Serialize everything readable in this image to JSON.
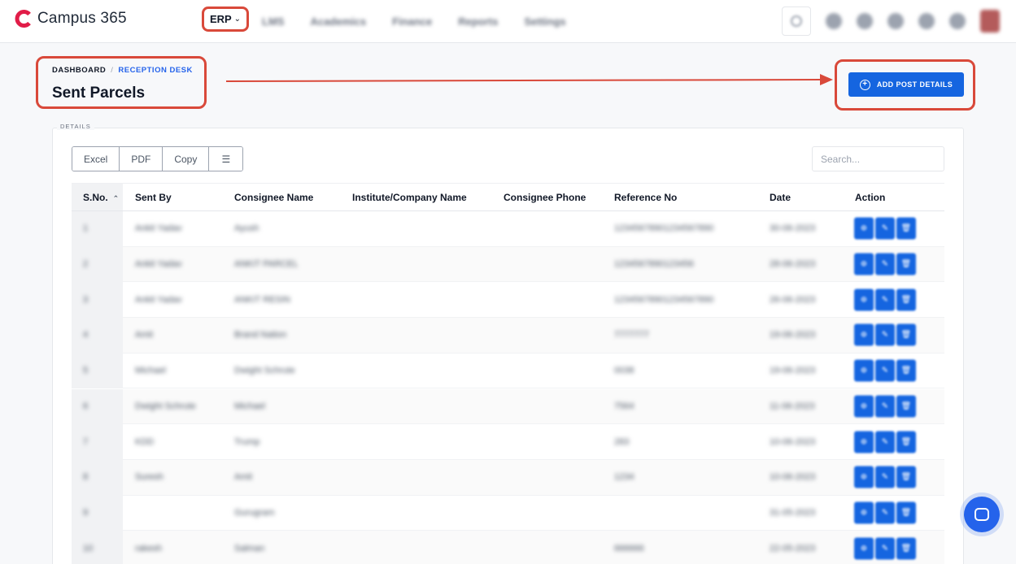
{
  "app": {
    "name": "Campus 365",
    "brand_color": "#e11d48",
    "accent": "#1565e0",
    "highlight": "#d9493a"
  },
  "nav": {
    "erp_label": "ERP",
    "items": [
      "LMS",
      "Academics",
      "Finance",
      "Reports",
      "Settings"
    ]
  },
  "breadcrumb": {
    "root": "DASHBOARD",
    "separator": "/",
    "current": "RECEPTION DESK"
  },
  "page_title": "Sent Parcels",
  "add_button_label": "ADD POST DETAILS",
  "details_legend": "DETAILS",
  "export": {
    "excel": "Excel",
    "pdf": "PDF",
    "copy": "Copy"
  },
  "search": {
    "placeholder": "Search..."
  },
  "table": {
    "headers": [
      "S.No.",
      "Sent By",
      "Consignee Name",
      "Institute/Company Name",
      "Consignee Phone",
      "Reference No",
      "Date",
      "Action"
    ],
    "rows": [
      [
        "1",
        "Ankit Yadav",
        "Ayush",
        "",
        "",
        "12345678901234567890",
        "30-06-2023"
      ],
      [
        "2",
        "Ankit Yadav",
        "ANKIT PARCEL",
        "",
        "",
        "1234567890123456",
        "28-06-2023"
      ],
      [
        "3",
        "Ankit Yadav",
        "ANKIT RESIN",
        "",
        "",
        "12345678901234567890",
        "26-06-2023"
      ],
      [
        "4",
        "Amit",
        "Brand Nation",
        "",
        "",
        "7777777",
        "19-06-2023"
      ],
      [
        "5",
        "Michael",
        "Dwight Schrute",
        "",
        "",
        "0038",
        "19-06-2023"
      ],
      [
        "6",
        "Dwight Schrute",
        "Michael",
        "",
        "",
        "7564",
        "11-06-2023"
      ],
      [
        "7",
        "KDD",
        "Trump",
        "",
        "",
        "283",
        "10-06-2023"
      ],
      [
        "8",
        "Suresh",
        "Amit",
        "",
        "",
        "1234",
        "10-06-2023"
      ],
      [
        "9",
        "",
        "Gurugram",
        "",
        "",
        "",
        "31-05-2023"
      ],
      [
        "10",
        "rakesh",
        "Salman",
        "",
        "",
        "666666",
        "22-05-2023"
      ]
    ]
  }
}
